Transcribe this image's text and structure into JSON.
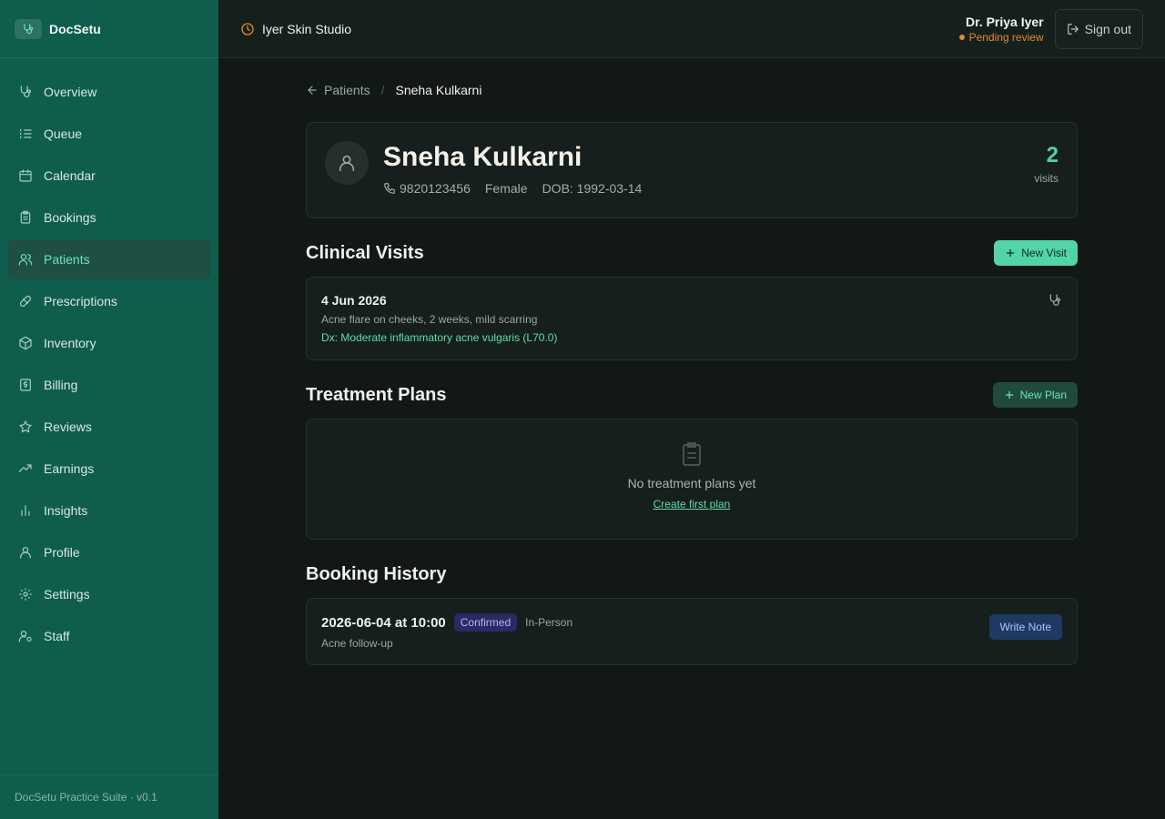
{
  "brand": {
    "name": "DocSetu",
    "icon": "stethoscope-icon"
  },
  "sidebar": {
    "items": [
      {
        "label": "Overview",
        "icon": "stethoscope-icon",
        "active": false
      },
      {
        "label": "Queue",
        "icon": "list-icon",
        "active": false
      },
      {
        "label": "Calendar",
        "icon": "calendar-icon",
        "active": false
      },
      {
        "label": "Bookings",
        "icon": "clipboard-icon",
        "active": false
      },
      {
        "label": "Patients",
        "icon": "users-icon",
        "active": true
      },
      {
        "label": "Prescriptions",
        "icon": "pill-icon",
        "active": false
      },
      {
        "label": "Inventory",
        "icon": "box-icon",
        "active": false
      },
      {
        "label": "Billing",
        "icon": "receipt-icon",
        "active": false
      },
      {
        "label": "Reviews",
        "icon": "star-icon",
        "active": false
      },
      {
        "label": "Earnings",
        "icon": "trending-up-icon",
        "active": false
      },
      {
        "label": "Insights",
        "icon": "bar-chart-icon",
        "active": false
      },
      {
        "label": "Profile",
        "icon": "user-icon",
        "active": false
      },
      {
        "label": "Settings",
        "icon": "gear-icon",
        "active": false
      },
      {
        "label": "Staff",
        "icon": "user-gear-icon",
        "active": false
      }
    ],
    "footer": "DocSetu Practice Suite · v0.1"
  },
  "topbar": {
    "clinic_name": "Iyer Skin Studio",
    "doctor_name": "Dr. Priya Iyer",
    "doctor_status": "Pending review",
    "sign_out": "Sign out"
  },
  "breadcrumb": {
    "back": "Patients",
    "separator": "/",
    "current": "Sneha Kulkarni"
  },
  "patient": {
    "name": "Sneha Kulkarni",
    "phone": "9820123456",
    "gender": "Female",
    "dob": "DOB: 1992-03-14",
    "visits_count": "2",
    "visits_label": "visits"
  },
  "clinical_visits": {
    "title": "Clinical Visits",
    "new_button": "New Visit",
    "items": [
      {
        "date": "4 Jun 2026",
        "complaint": "Acne flare on cheeks, 2 weeks, mild scarring",
        "diagnosis": "Dx: Moderate inflammatory acne vulgaris (L70.0)"
      }
    ]
  },
  "treatment_plans": {
    "title": "Treatment Plans",
    "new_button": "New Plan",
    "empty_text": "No treatment plans yet",
    "empty_link": "Create first plan"
  },
  "booking_history": {
    "title": "Booking History",
    "items": [
      {
        "when": "2026-06-04 at 10:00",
        "status": "Confirmed",
        "type": "In-Person",
        "reason": "Acne follow-up",
        "action": "Write Note"
      }
    ]
  },
  "colors": {
    "sidebar_bg": "#0f5e4d",
    "accent": "#53d3a8",
    "warning": "#e08a2a",
    "background": "#111816"
  }
}
